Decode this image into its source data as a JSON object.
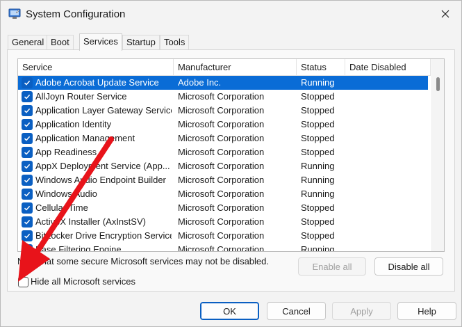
{
  "window": {
    "title": "System Configuration",
    "icon": "system-config-icon"
  },
  "tabs": [
    {
      "label": "General",
      "active": false
    },
    {
      "label": "Boot",
      "active": false
    },
    {
      "label": "Services",
      "active": true
    },
    {
      "label": "Startup",
      "active": false
    },
    {
      "label": "Tools",
      "active": false
    }
  ],
  "services_table": {
    "columns": [
      "Service",
      "Manufacturer",
      "Status",
      "Date Disabled"
    ],
    "rows": [
      {
        "service": "Adobe Acrobat Update Service",
        "manufacturer": "Adobe Inc.",
        "status": "Running",
        "checked": true,
        "selected": true
      },
      {
        "service": "AllJoyn Router Service",
        "manufacturer": "Microsoft Corporation",
        "status": "Stopped",
        "checked": true
      },
      {
        "service": "Application Layer Gateway Service",
        "manufacturer": "Microsoft Corporation",
        "status": "Stopped",
        "checked": true
      },
      {
        "service": "Application Identity",
        "manufacturer": "Microsoft Corporation",
        "status": "Stopped",
        "checked": true
      },
      {
        "service": "Application Management",
        "manufacturer": "Microsoft Corporation",
        "status": "Stopped",
        "checked": true
      },
      {
        "service": "App Readiness",
        "manufacturer": "Microsoft Corporation",
        "status": "Stopped",
        "checked": true
      },
      {
        "service": "AppX Deployment Service (App...",
        "manufacturer": "Microsoft Corporation",
        "status": "Running",
        "checked": true
      },
      {
        "service": "Windows Audio Endpoint Builder",
        "manufacturer": "Microsoft Corporation",
        "status": "Running",
        "checked": true
      },
      {
        "service": "Windows Audio",
        "manufacturer": "Microsoft Corporation",
        "status": "Running",
        "checked": true
      },
      {
        "service": "Cellular Time",
        "manufacturer": "Microsoft Corporation",
        "status": "Stopped",
        "checked": true
      },
      {
        "service": "ActiveX Installer (AxInstSV)",
        "manufacturer": "Microsoft Corporation",
        "status": "Stopped",
        "checked": true
      },
      {
        "service": "BitLocker Drive Encryption Service",
        "manufacturer": "Microsoft Corporation",
        "status": "Stopped",
        "checked": true
      },
      {
        "service": "Base Filtering Engine",
        "manufacturer": "Microsoft Corporation",
        "status": "Running",
        "checked": true
      }
    ]
  },
  "note": "Note that some secure Microsoft services may not be disabled.",
  "hide_microsoft": {
    "label": "Hide all Microsoft services",
    "checked": false
  },
  "buttons": {
    "enable_all": "Enable all",
    "disable_all": "Disable all",
    "ok": "OK",
    "cancel": "Cancel",
    "apply": "Apply",
    "help": "Help"
  },
  "colors": {
    "selection": "#0a6cd6",
    "checkbox": "#0a5fc2",
    "annotation_arrow": "#e8131a"
  }
}
